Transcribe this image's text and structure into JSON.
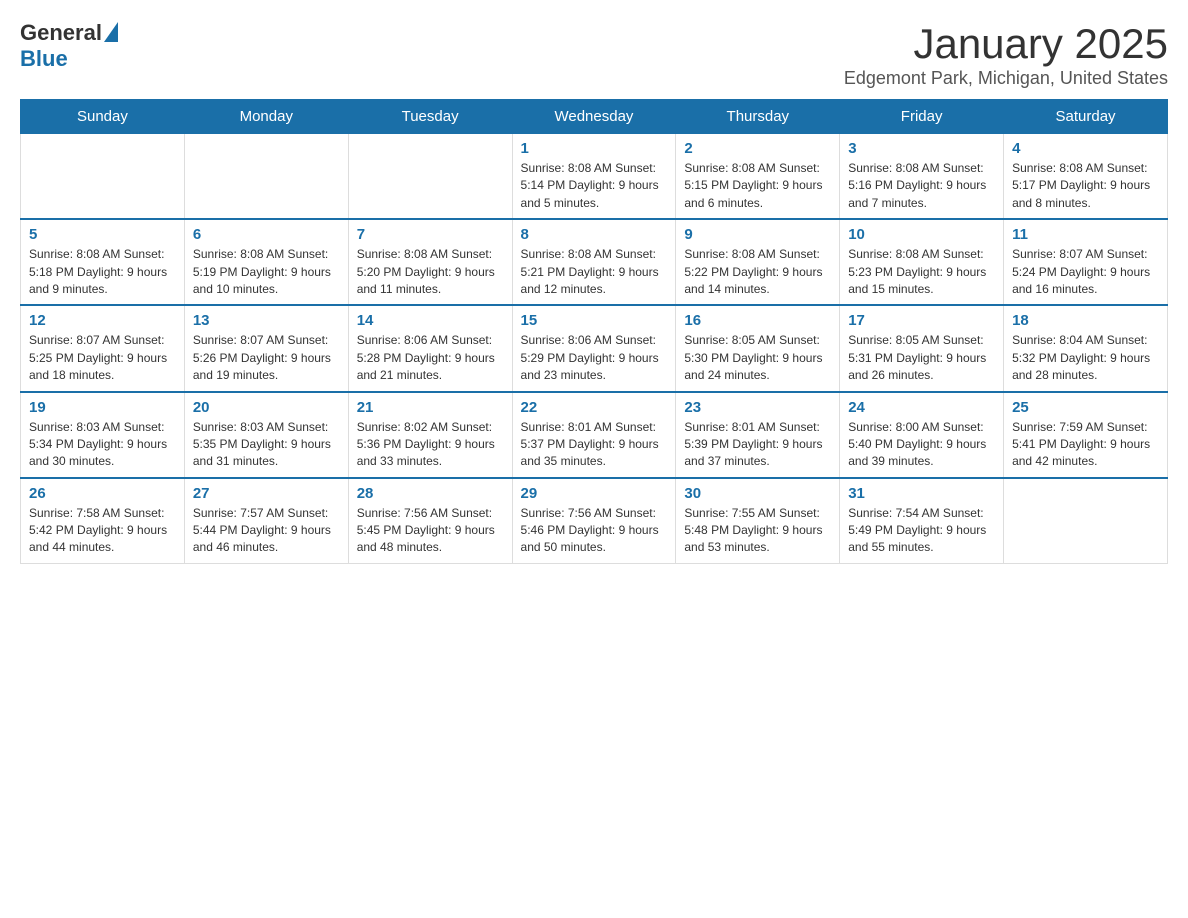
{
  "header": {
    "logo_general": "General",
    "logo_blue": "Blue",
    "title": "January 2025",
    "subtitle": "Edgemont Park, Michigan, United States"
  },
  "days_of_week": [
    "Sunday",
    "Monday",
    "Tuesday",
    "Wednesday",
    "Thursday",
    "Friday",
    "Saturday"
  ],
  "weeks": [
    [
      {
        "day": "",
        "info": ""
      },
      {
        "day": "",
        "info": ""
      },
      {
        "day": "",
        "info": ""
      },
      {
        "day": "1",
        "info": "Sunrise: 8:08 AM\nSunset: 5:14 PM\nDaylight: 9 hours and 5 minutes."
      },
      {
        "day": "2",
        "info": "Sunrise: 8:08 AM\nSunset: 5:15 PM\nDaylight: 9 hours and 6 minutes."
      },
      {
        "day": "3",
        "info": "Sunrise: 8:08 AM\nSunset: 5:16 PM\nDaylight: 9 hours and 7 minutes."
      },
      {
        "day": "4",
        "info": "Sunrise: 8:08 AM\nSunset: 5:17 PM\nDaylight: 9 hours and 8 minutes."
      }
    ],
    [
      {
        "day": "5",
        "info": "Sunrise: 8:08 AM\nSunset: 5:18 PM\nDaylight: 9 hours and 9 minutes."
      },
      {
        "day": "6",
        "info": "Sunrise: 8:08 AM\nSunset: 5:19 PM\nDaylight: 9 hours and 10 minutes."
      },
      {
        "day": "7",
        "info": "Sunrise: 8:08 AM\nSunset: 5:20 PM\nDaylight: 9 hours and 11 minutes."
      },
      {
        "day": "8",
        "info": "Sunrise: 8:08 AM\nSunset: 5:21 PM\nDaylight: 9 hours and 12 minutes."
      },
      {
        "day": "9",
        "info": "Sunrise: 8:08 AM\nSunset: 5:22 PM\nDaylight: 9 hours and 14 minutes."
      },
      {
        "day": "10",
        "info": "Sunrise: 8:08 AM\nSunset: 5:23 PM\nDaylight: 9 hours and 15 minutes."
      },
      {
        "day": "11",
        "info": "Sunrise: 8:07 AM\nSunset: 5:24 PM\nDaylight: 9 hours and 16 minutes."
      }
    ],
    [
      {
        "day": "12",
        "info": "Sunrise: 8:07 AM\nSunset: 5:25 PM\nDaylight: 9 hours and 18 minutes."
      },
      {
        "day": "13",
        "info": "Sunrise: 8:07 AM\nSunset: 5:26 PM\nDaylight: 9 hours and 19 minutes."
      },
      {
        "day": "14",
        "info": "Sunrise: 8:06 AM\nSunset: 5:28 PM\nDaylight: 9 hours and 21 minutes."
      },
      {
        "day": "15",
        "info": "Sunrise: 8:06 AM\nSunset: 5:29 PM\nDaylight: 9 hours and 23 minutes."
      },
      {
        "day": "16",
        "info": "Sunrise: 8:05 AM\nSunset: 5:30 PM\nDaylight: 9 hours and 24 minutes."
      },
      {
        "day": "17",
        "info": "Sunrise: 8:05 AM\nSunset: 5:31 PM\nDaylight: 9 hours and 26 minutes."
      },
      {
        "day": "18",
        "info": "Sunrise: 8:04 AM\nSunset: 5:32 PM\nDaylight: 9 hours and 28 minutes."
      }
    ],
    [
      {
        "day": "19",
        "info": "Sunrise: 8:03 AM\nSunset: 5:34 PM\nDaylight: 9 hours and 30 minutes."
      },
      {
        "day": "20",
        "info": "Sunrise: 8:03 AM\nSunset: 5:35 PM\nDaylight: 9 hours and 31 minutes."
      },
      {
        "day": "21",
        "info": "Sunrise: 8:02 AM\nSunset: 5:36 PM\nDaylight: 9 hours and 33 minutes."
      },
      {
        "day": "22",
        "info": "Sunrise: 8:01 AM\nSunset: 5:37 PM\nDaylight: 9 hours and 35 minutes."
      },
      {
        "day": "23",
        "info": "Sunrise: 8:01 AM\nSunset: 5:39 PM\nDaylight: 9 hours and 37 minutes."
      },
      {
        "day": "24",
        "info": "Sunrise: 8:00 AM\nSunset: 5:40 PM\nDaylight: 9 hours and 39 minutes."
      },
      {
        "day": "25",
        "info": "Sunrise: 7:59 AM\nSunset: 5:41 PM\nDaylight: 9 hours and 42 minutes."
      }
    ],
    [
      {
        "day": "26",
        "info": "Sunrise: 7:58 AM\nSunset: 5:42 PM\nDaylight: 9 hours and 44 minutes."
      },
      {
        "day": "27",
        "info": "Sunrise: 7:57 AM\nSunset: 5:44 PM\nDaylight: 9 hours and 46 minutes."
      },
      {
        "day": "28",
        "info": "Sunrise: 7:56 AM\nSunset: 5:45 PM\nDaylight: 9 hours and 48 minutes."
      },
      {
        "day": "29",
        "info": "Sunrise: 7:56 AM\nSunset: 5:46 PM\nDaylight: 9 hours and 50 minutes."
      },
      {
        "day": "30",
        "info": "Sunrise: 7:55 AM\nSunset: 5:48 PM\nDaylight: 9 hours and 53 minutes."
      },
      {
        "day": "31",
        "info": "Sunrise: 7:54 AM\nSunset: 5:49 PM\nDaylight: 9 hours and 55 minutes."
      },
      {
        "day": "",
        "info": ""
      }
    ]
  ]
}
